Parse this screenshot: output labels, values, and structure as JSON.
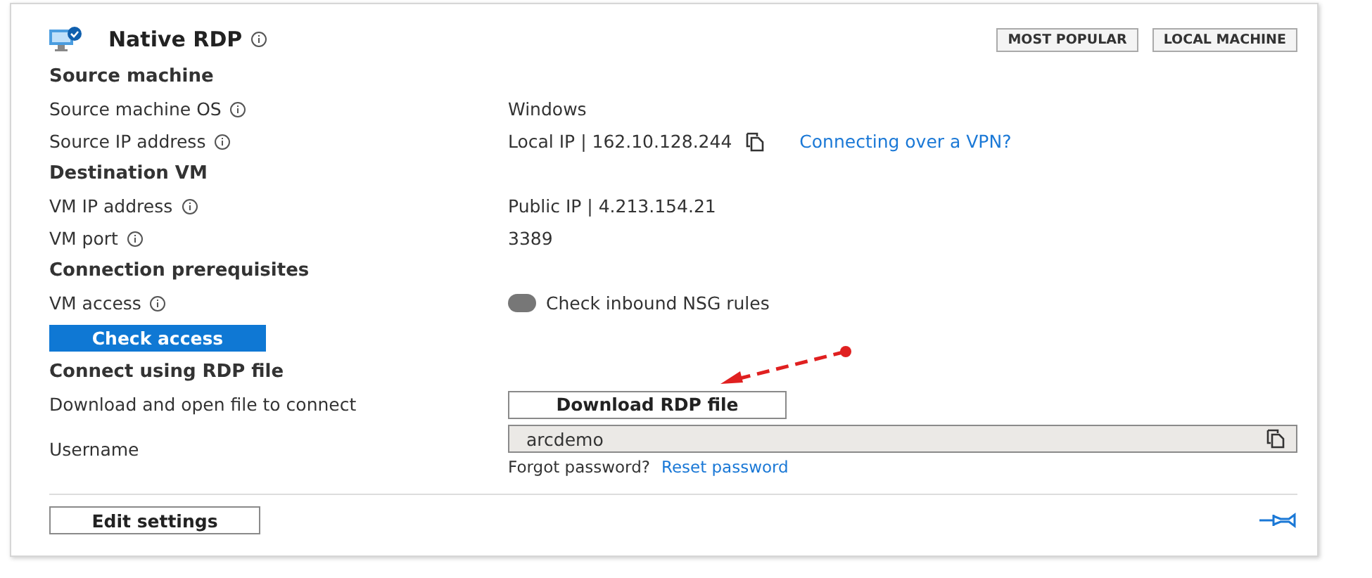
{
  "header": {
    "title": "Native RDP",
    "info": true,
    "badges": [
      "MOST POPULAR",
      "LOCAL MACHINE"
    ]
  },
  "sections": [
    {
      "heading": "Source machine",
      "rows": [
        {
          "kind": "text",
          "label": "Source machine OS",
          "info": true,
          "value": "Windows"
        },
        {
          "kind": "copy",
          "label": "Source IP address",
          "info": true,
          "value": "Local IP | 162.10.128.244",
          "link": "Connecting over a VPN?"
        }
      ]
    },
    {
      "heading": "Destination VM",
      "rows": [
        {
          "kind": "text",
          "label": "VM IP address",
          "info": true,
          "value": "Public IP | 4.213.154.21"
        },
        {
          "kind": "text",
          "label": "VM port",
          "info": true,
          "value": "3389"
        }
      ]
    },
    {
      "heading": "Connection prerequisites",
      "rows": [
        {
          "kind": "status",
          "label": "VM access",
          "info": true,
          "value": "Check inbound NSG rules"
        },
        {
          "kind": "primary",
          "button": "Check access"
        }
      ]
    },
    {
      "heading": "Connect using RDP file",
      "rows": [
        {
          "kind": "button",
          "label": "Download and open file to connect",
          "info": false,
          "button": "Download RDP file"
        },
        {
          "kind": "field",
          "label": "Username",
          "info": false,
          "value": "arcdemo",
          "hint": "Forgot password?",
          "link": "Reset password"
        }
      ]
    }
  ],
  "footer": {
    "button": "Edit settings"
  }
}
